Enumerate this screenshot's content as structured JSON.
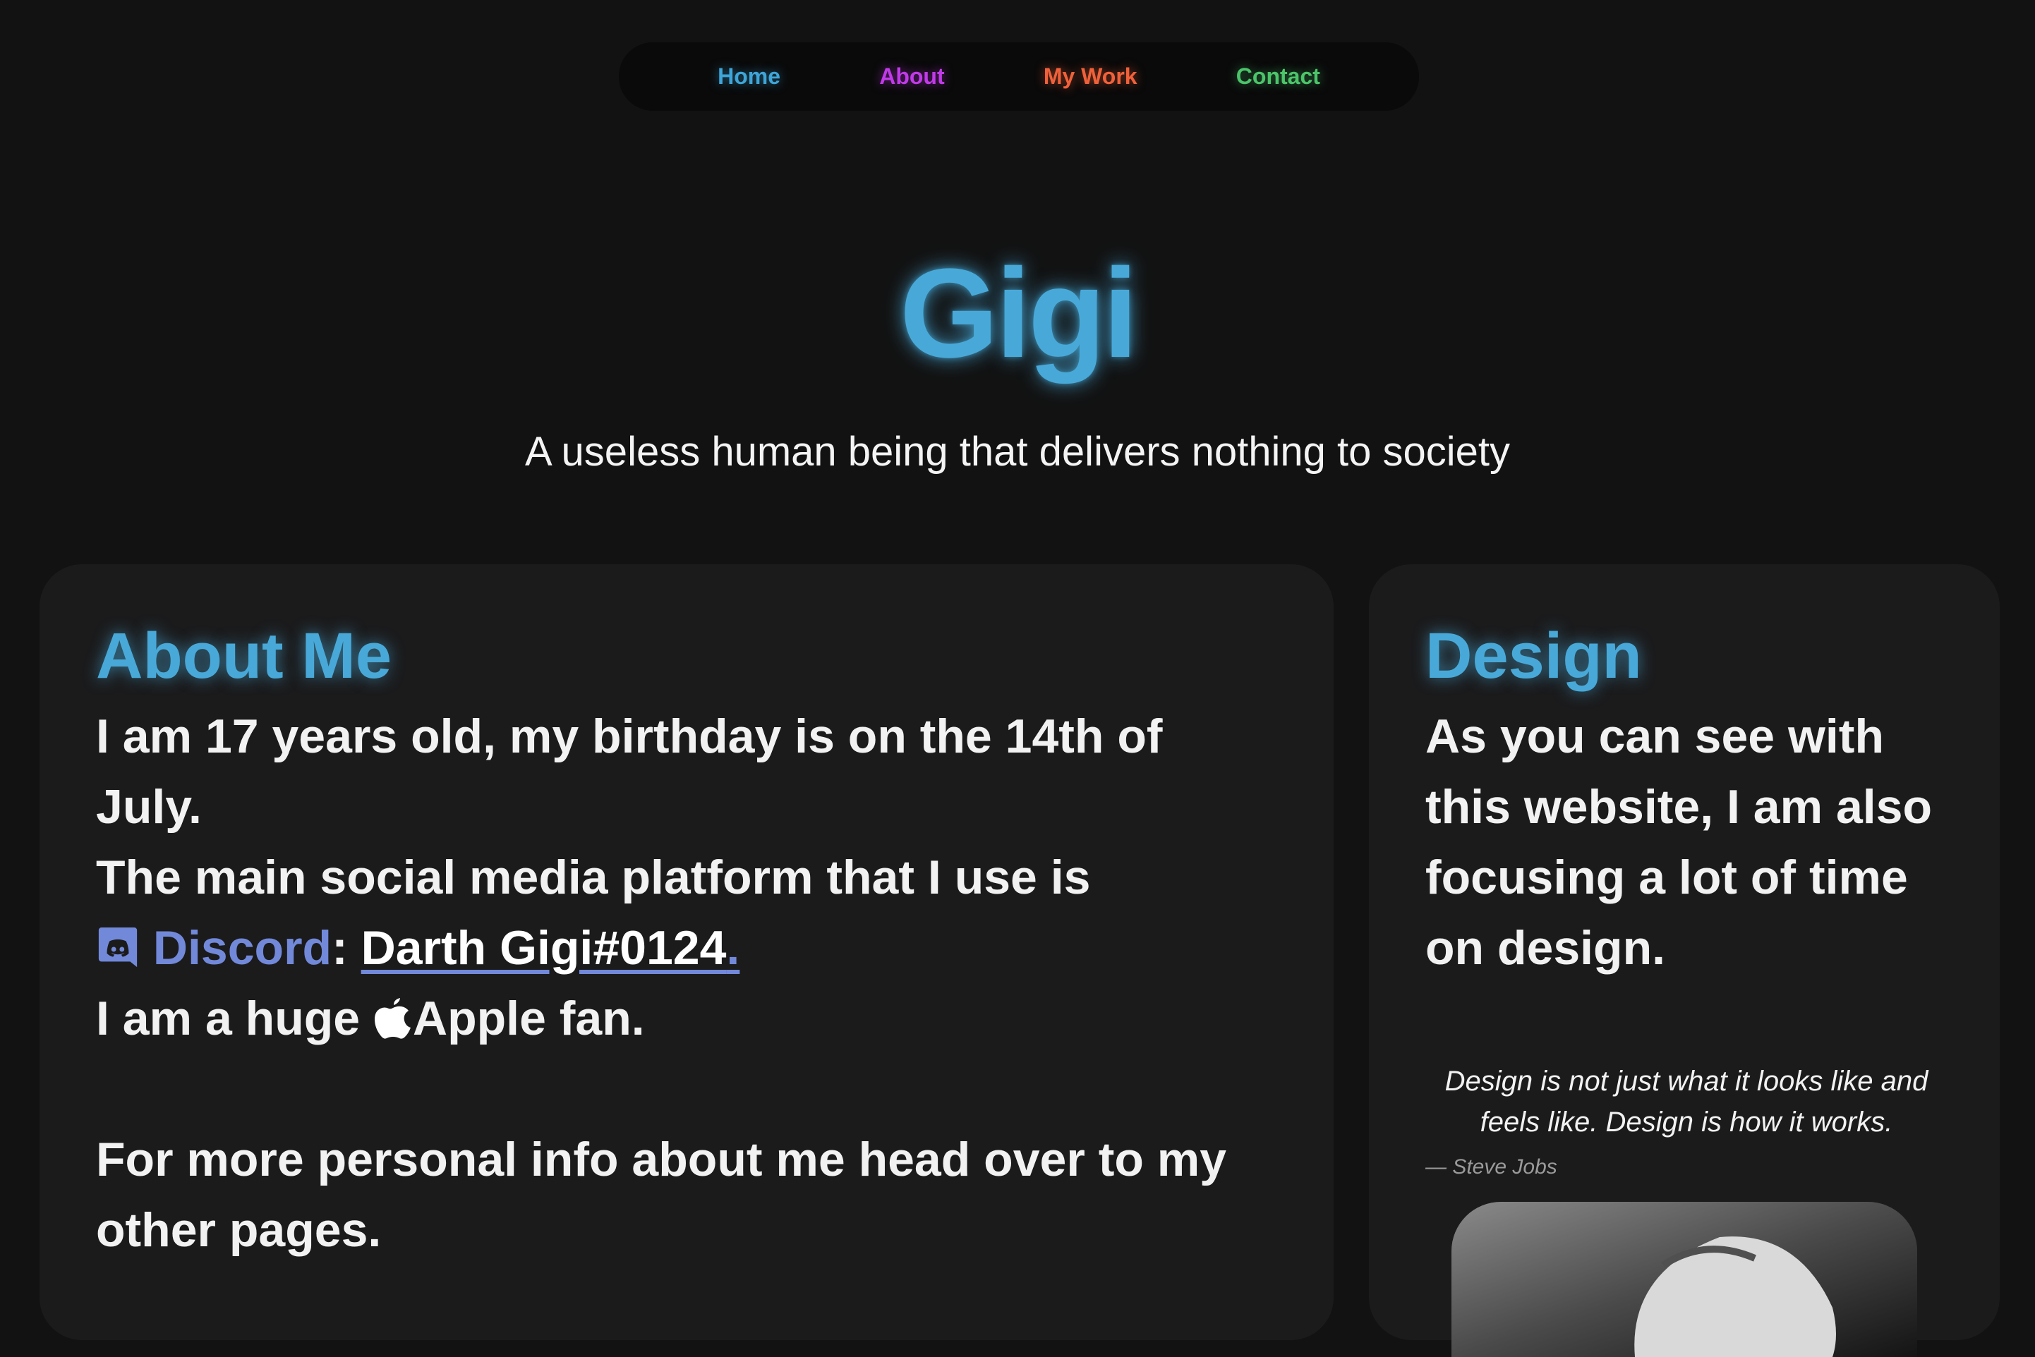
{
  "nav": {
    "home": "Home",
    "about": "About",
    "work": "My Work",
    "contact": "Contact"
  },
  "hero": {
    "title": "Gigi",
    "subtitle": "A useless human being that delivers nothing to society"
  },
  "about": {
    "heading": "About Me",
    "line1": "I am 17 years old, my birthday is on the 14th of July.",
    "line2": "The main social media platform that I use is",
    "discord_label": "Discord",
    "colon": ": ",
    "discord_handle": "Darth Gigi#0124",
    "handle_end": ".",
    "apple_pre": "I am a huge ",
    "apple_post": "Apple fan.",
    "more": "For more personal info about me head over to my other pages."
  },
  "design": {
    "heading": "Design",
    "text": "As you can see with this website, I am also focusing a lot of time on design.",
    "quote": "Design is not just what it looks like and feels like. Design is how it works.",
    "quote_author": "— Steve Jobs"
  },
  "colors": {
    "background": "#121212",
    "card": "#1b1b1c",
    "accent_blue": "#48a9d8",
    "nav_home": "#3ea5d8",
    "nav_about": "#c13ae8",
    "nav_work": "#f0613a",
    "nav_contact": "#4cc46a",
    "discord": "#7289da"
  },
  "icons": {
    "discord": "discord-icon",
    "apple": "apple-icon"
  }
}
